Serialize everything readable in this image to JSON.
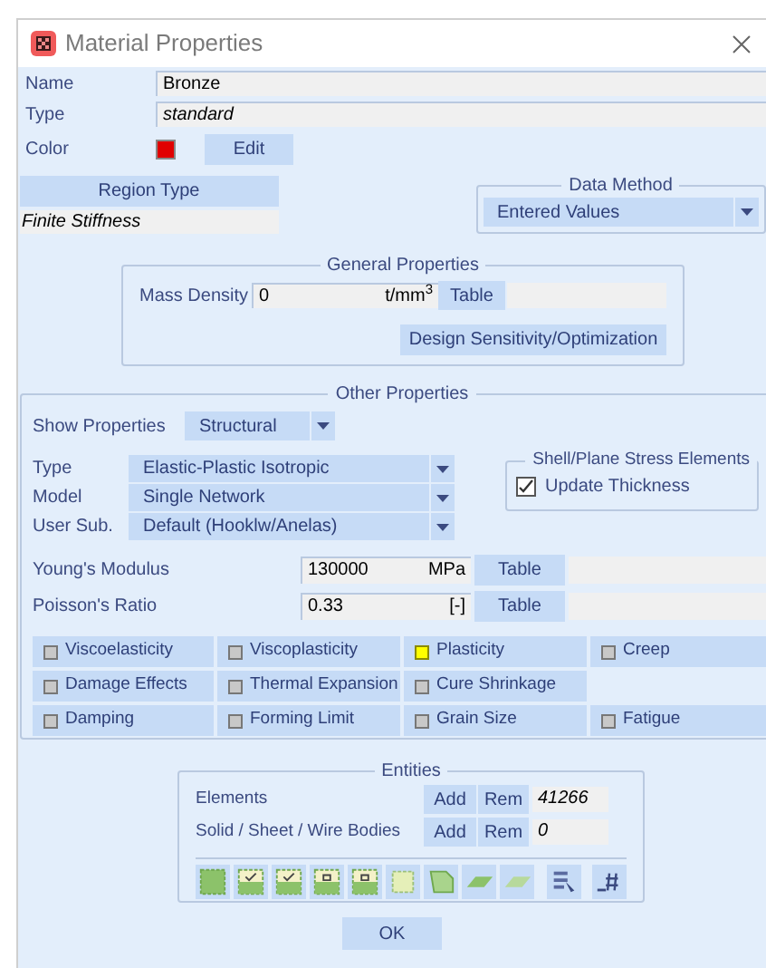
{
  "window": {
    "title": "Material Properties"
  },
  "name": {
    "label": "Name",
    "value": "Bronze"
  },
  "type": {
    "label": "Type",
    "value": "standard"
  },
  "color": {
    "label": "Color",
    "color": "#e00000",
    "button": "Edit"
  },
  "region_type": {
    "button": "Region Type",
    "value": "Finite Stiffness"
  },
  "data_method": {
    "title": "Data Method",
    "value": "Entered Values"
  },
  "general_properties": {
    "title": "General Properties",
    "mass_density": {
      "label": "Mass Density",
      "value": "0",
      "unit": "t/mm$^{3}$",
      "button": "Table"
    },
    "design_button": "Design Sensitivity/Optimization"
  },
  "other_properties": {
    "title": "Other Properties",
    "show_properties": {
      "label": "Show Properties",
      "value": "Structural"
    },
    "selectors": [
      {
        "label": "Type",
        "value": "Elastic-Plastic Isotropic"
      },
      {
        "label": "Model",
        "value": "Single Network"
      },
      {
        "label": "User Sub.",
        "value": "Default (Hooklw/Anelas)"
      }
    ],
    "shell": {
      "title": "Shell/Plane Stress Elements",
      "checkbox": {
        "label": "Update Thickness",
        "checked": true
      }
    },
    "moduli": [
      {
        "label": "Young's Modulus",
        "value": "130000",
        "unit": "MPa",
        "button": "Table"
      },
      {
        "label": "Poisson's Ratio",
        "value": "0.33",
        "unit": "[-]",
        "button": "Table"
      }
    ],
    "option_rows": [
      [
        {
          "label": "Viscoelasticity",
          "on": false
        },
        {
          "label": "Viscoplasticity",
          "on": false
        },
        {
          "label": "Plasticity",
          "on": true
        },
        {
          "label": "Creep",
          "on": false
        }
      ],
      [
        {
          "label": "Damage Effects",
          "on": false
        },
        {
          "label": "Thermal Expansion",
          "on": false
        },
        {
          "label": "Cure Shrinkage",
          "on": false
        }
      ],
      [
        {
          "label": "Damping",
          "on": false
        },
        {
          "label": "Forming Limit",
          "on": false
        },
        {
          "label": "Grain Size",
          "on": false
        },
        {
          "label": "Fatigue",
          "on": false
        }
      ]
    ]
  },
  "entities": {
    "title": "Entities",
    "rows": [
      {
        "label": "Elements",
        "add": "Add",
        "rem": "Rem",
        "count": "41266"
      },
      {
        "label": "Solid / Sheet / Wire Bodies",
        "add": "Add",
        "rem": "Rem",
        "count": "0"
      }
    ]
  },
  "buttons": [
    "OK"
  ]
}
